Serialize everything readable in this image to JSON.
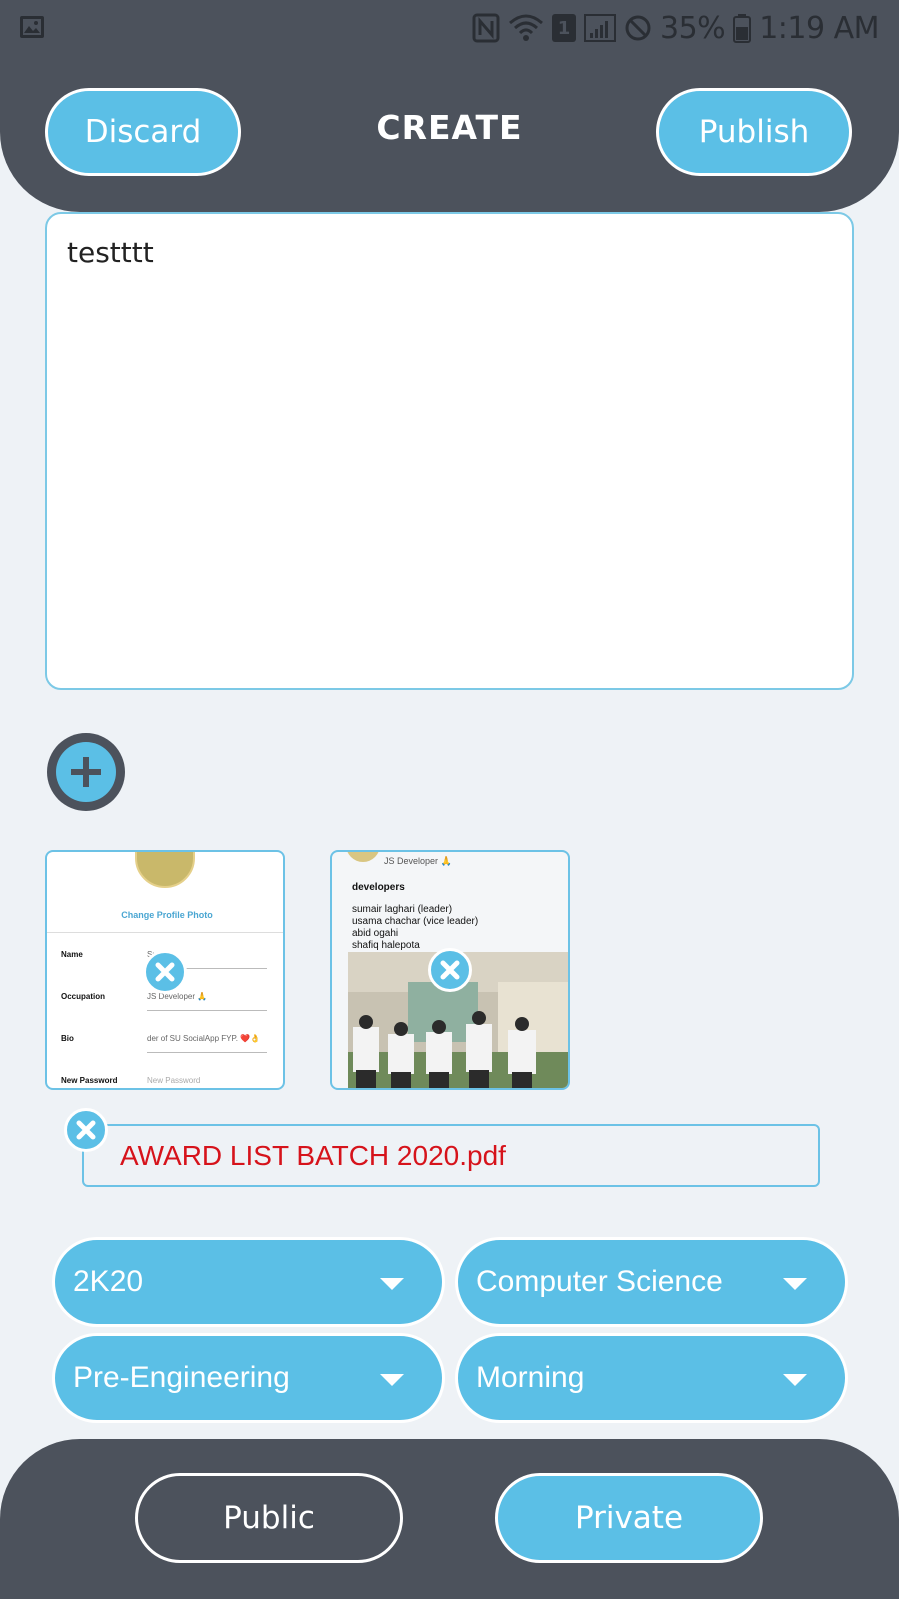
{
  "status_bar": {
    "battery": "35%",
    "time": "1:19 AM",
    "sim_slot": "1",
    "icons": [
      "image-icon",
      "nfc-icon",
      "wifi-icon",
      "sim-icon",
      "signal-icon",
      "dnd-icon",
      "battery-icon"
    ]
  },
  "header": {
    "discard_label": "Discard",
    "title": "CREATE",
    "publish_label": "Publish"
  },
  "editor": {
    "text": "testttt"
  },
  "attachments": {
    "images": [
      {
        "kind": "screenshot-profile",
        "change_photo": "Change Profile Photo",
        "fields": [
          {
            "label": "Name",
            "value": "Sumair"
          },
          {
            "label": "Occupation",
            "value": "JS Developer 🙏"
          },
          {
            "label": "Bio",
            "value": "der of SU SocialApp FYP. ❤️👌"
          },
          {
            "label": "New Password",
            "value": "New Password"
          }
        ]
      },
      {
        "kind": "screenshot-post",
        "header": "JS Developer 🙏",
        "lines": [
          "developers",
          "",
          "sumair laghari (leader)",
          "usama chachar (vice leader)",
          "abid ogahi",
          "shafiq halepota"
        ]
      }
    ],
    "file": {
      "name": "AWARD LIST BATCH 2020.pdf"
    }
  },
  "filters": {
    "batch": "2K20",
    "department": "Computer Science",
    "group": "Pre-Engineering",
    "shift": "Morning"
  },
  "visibility": {
    "public_label": "Public",
    "private_label": "Private"
  },
  "colors": {
    "accent": "#5bbfe6",
    "dark": "#4c525c",
    "background": "#eef2f6",
    "file_text": "#d6131b"
  }
}
